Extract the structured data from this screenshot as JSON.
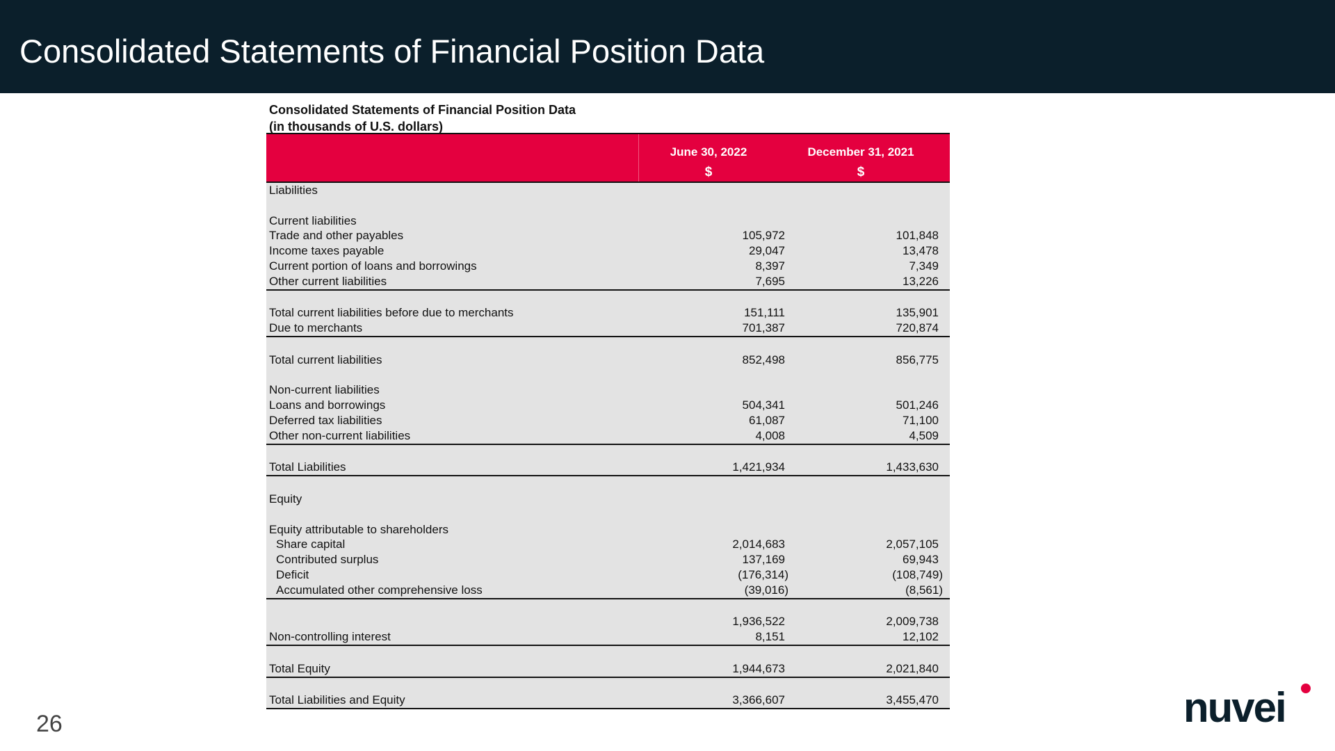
{
  "header": {
    "title": "Consolidated Statements of Financial Position Data"
  },
  "caption": {
    "line1": "Consolidated Statements of Financial Position Data",
    "line2": "(in thousands of U.S. dollars)"
  },
  "table": {
    "columns": [
      "June 30, 2022",
      "December 31, 2021"
    ],
    "currency": [
      "$",
      "$"
    ],
    "rows": [
      {
        "label": "Liabilities",
        "v1": "",
        "v2": ""
      },
      {
        "label": "",
        "v1": "",
        "v2": ""
      },
      {
        "label": "Current liabilities",
        "v1": "",
        "v2": ""
      },
      {
        "label": "Trade and other payables",
        "v1": "105,972",
        "v2": "101,848"
      },
      {
        "label": "Income taxes payable",
        "v1": "29,047",
        "v2": "13,478"
      },
      {
        "label": "Current portion of loans and borrowings",
        "v1": "8,397",
        "v2": "7,349"
      },
      {
        "label": "Other current liabilities",
        "v1": "7,695",
        "v2": "13,226"
      },
      {
        "label": "",
        "v1": "",
        "v2": ""
      },
      {
        "label": "Total current liabilities before due to merchants",
        "v1": "151,111",
        "v2": "135,901"
      },
      {
        "label": "Due to merchants",
        "v1": "701,387",
        "v2": "720,874"
      },
      {
        "label": "",
        "v1": "",
        "v2": ""
      },
      {
        "label": "Total current liabilities",
        "v1": "852,498",
        "v2": "856,775"
      },
      {
        "label": "",
        "v1": "",
        "v2": ""
      },
      {
        "label": "Non-current liabilities",
        "v1": "",
        "v2": ""
      },
      {
        "label": "Loans and borrowings",
        "v1": "504,341",
        "v2": "501,246"
      },
      {
        "label": "Deferred tax liabilities",
        "v1": "61,087",
        "v2": "71,100"
      },
      {
        "label": "Other non-current liabilities",
        "v1": "4,008",
        "v2": "4,509"
      },
      {
        "label": "",
        "v1": "",
        "v2": ""
      },
      {
        "label": "Total Liabilities",
        "v1": "1,421,934",
        "v2": "1,433,630"
      },
      {
        "label": "",
        "v1": "",
        "v2": ""
      },
      {
        "label": "Equity",
        "v1": "",
        "v2": ""
      },
      {
        "label": "",
        "v1": "",
        "v2": ""
      },
      {
        "label": "Equity attributable to shareholders",
        "v1": "",
        "v2": ""
      },
      {
        "label": "Share capital",
        "v1": "2,014,683",
        "v2": "2,057,105"
      },
      {
        "label": "Contributed surplus",
        "v1": "137,169",
        "v2": "69,943"
      },
      {
        "label": "Deficit",
        "v1": "(176,314)",
        "v2": "(108,749)"
      },
      {
        "label": "Accumulated other comprehensive loss",
        "v1": "(39,016)",
        "v2": "(8,561)"
      },
      {
        "label": "",
        "v1": "",
        "v2": ""
      },
      {
        "label": "",
        "v1": "1,936,522",
        "v2": "2,009,738"
      },
      {
        "label": "Non-controlling interest",
        "v1": "8,151",
        "v2": "12,102"
      },
      {
        "label": "",
        "v1": "",
        "v2": ""
      },
      {
        "label": "Total Equity",
        "v1": "1,944,673",
        "v2": "2,021,840"
      },
      {
        "label": "",
        "v1": "",
        "v2": ""
      },
      {
        "label": "Total Liabilities and Equity",
        "v1": "3,366,607",
        "v2": "3,455,470"
      }
    ]
  },
  "footer": {
    "page_number": "26",
    "logo_text": "nuvei"
  },
  "colors": {
    "header_bg": "#0b1f2b",
    "table_header": "#e4003f",
    "table_body": "#e3e3e3",
    "logo_dot": "#e4003f"
  }
}
